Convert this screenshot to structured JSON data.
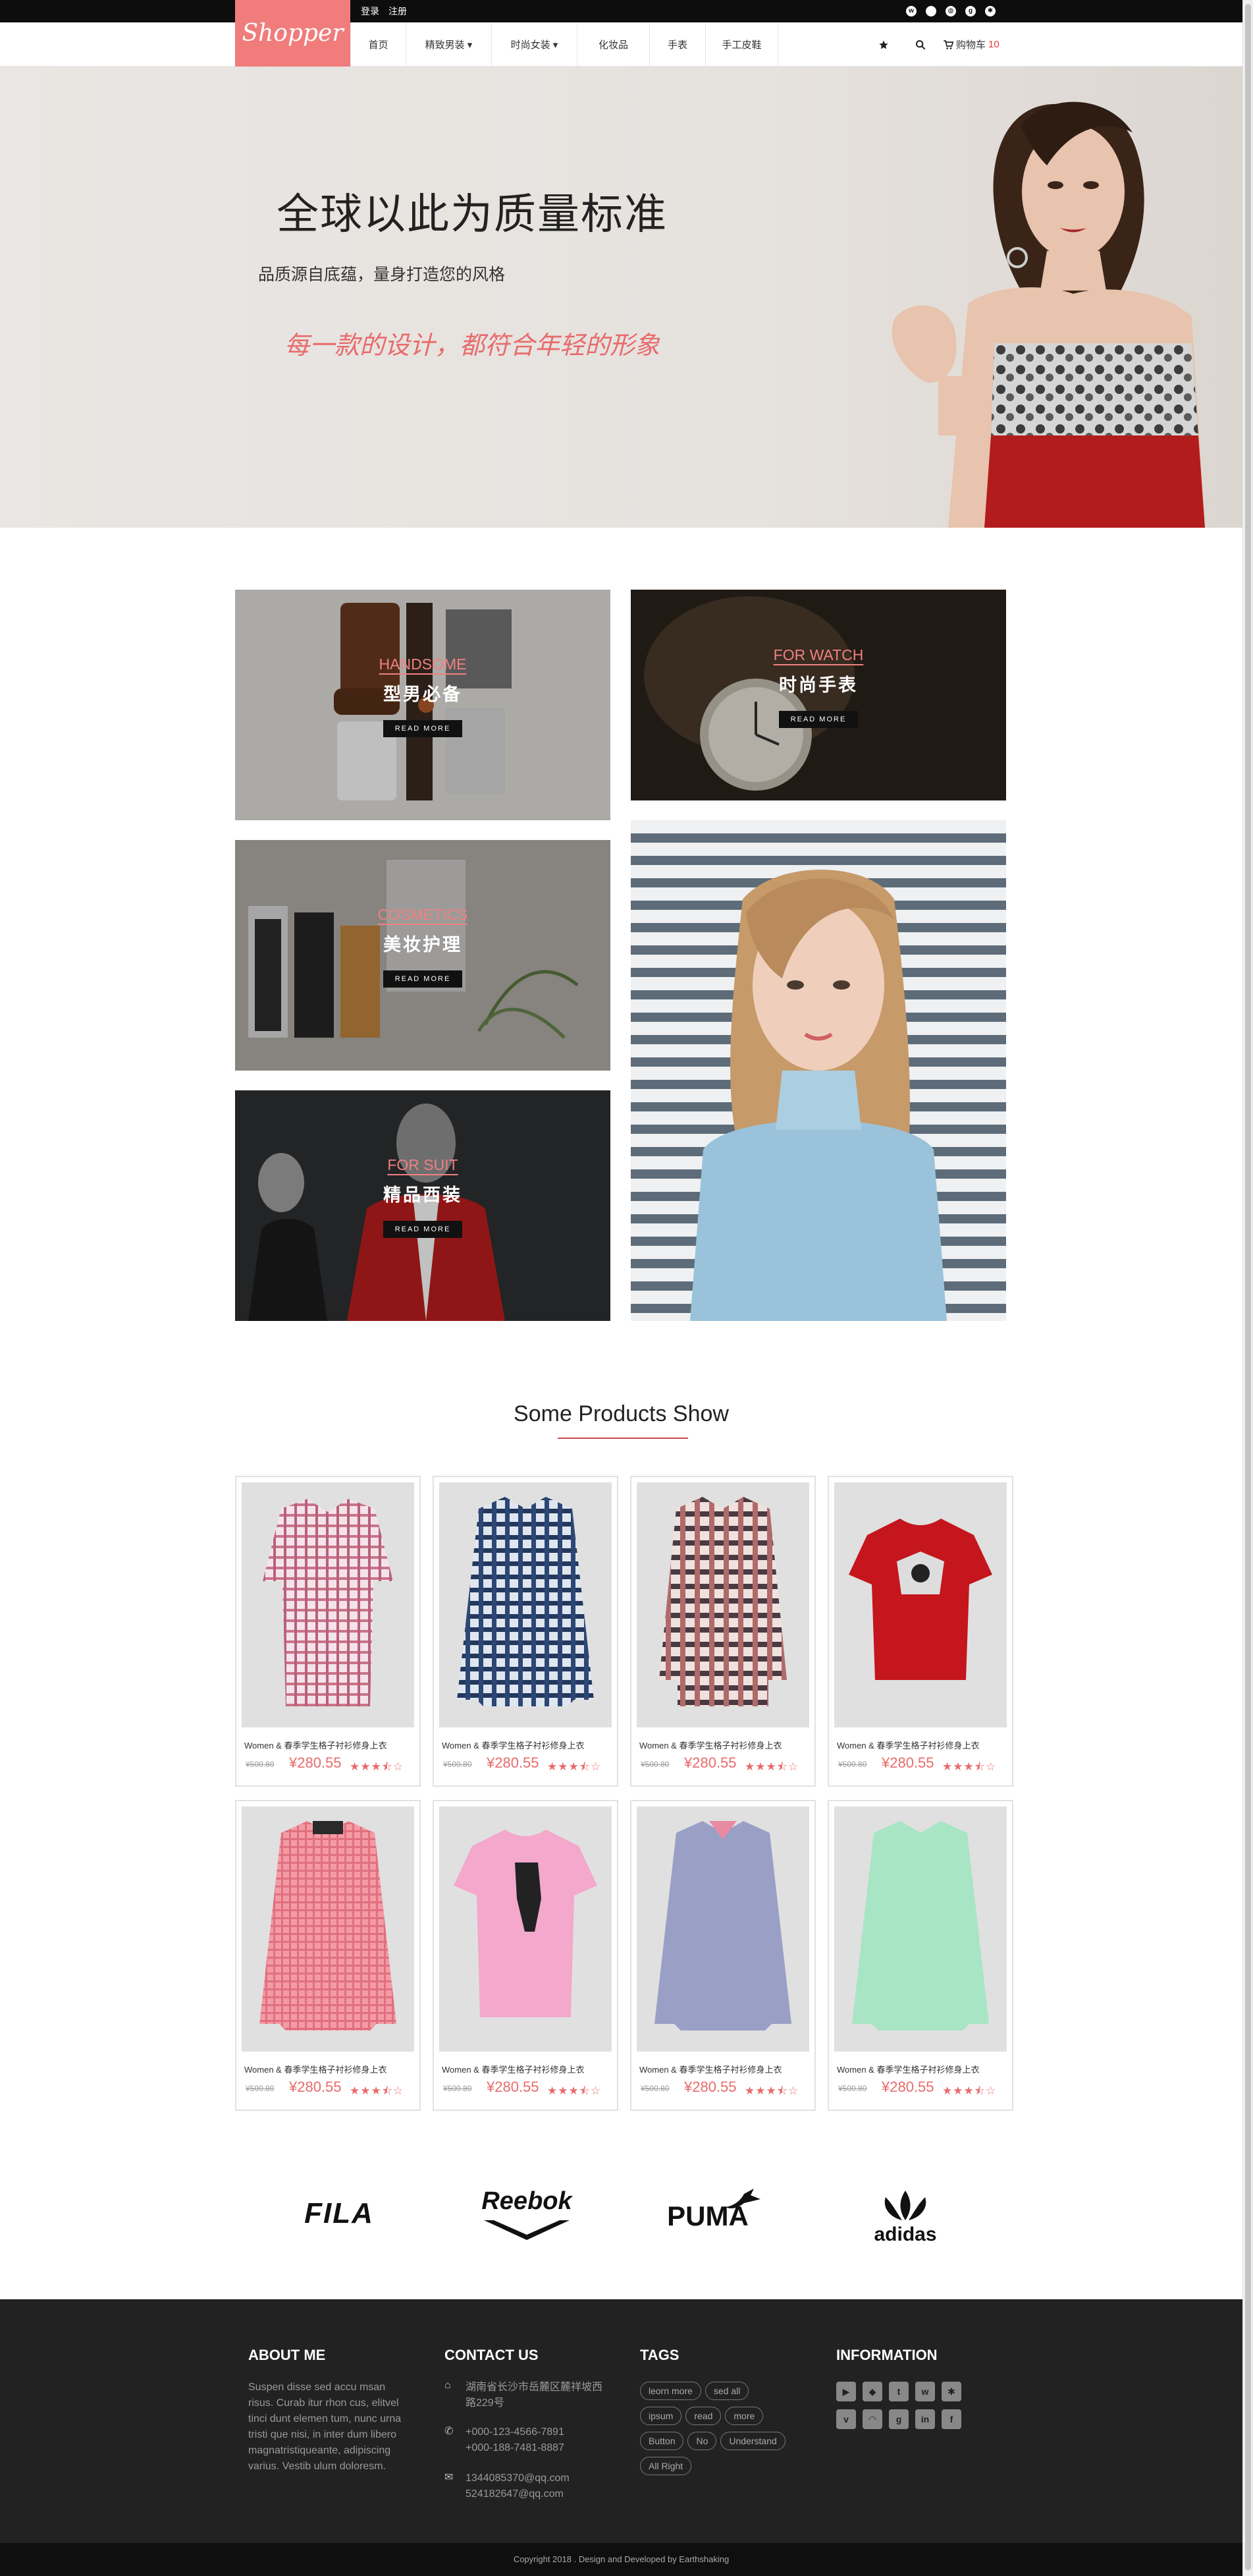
{
  "topbar": {
    "login": "登录",
    "register": "注册",
    "social": [
      "weibo-icon",
      "apple-icon",
      "dribbble-icon",
      "google-plus-icon",
      "yelp-icon"
    ]
  },
  "brand": {
    "logo": "Shopper"
  },
  "nav": [
    {
      "label": "首页"
    },
    {
      "label": "精致男装 ▾"
    },
    {
      "label": "时尚女装 ▾"
    },
    {
      "label": "化妆品"
    },
    {
      "label": "手表"
    },
    {
      "label": "手工皮鞋"
    }
  ],
  "navright": {
    "cart_label": "购物车",
    "cart_count": "10"
  },
  "hero": {
    "title": "全球以此为质量标准",
    "subtitle": "品质源自底蕴，量身打造您的风格",
    "tagline": "每一款的设计，都符合年轻的形象"
  },
  "categories": [
    {
      "en": "HANDSOME",
      "zh": "型男必备",
      "button": "READ MORE"
    },
    {
      "en": "FOR WATCH",
      "zh": "时尚手表",
      "button": "READ MORE"
    },
    {
      "en": "COSMETICS",
      "zh": "美妆护理",
      "button": "READ MORE"
    },
    {
      "en": "FOR SUIT",
      "zh": "精品西装",
      "button": "READ MORE"
    }
  ],
  "products_section": {
    "title": "Some Products Show"
  },
  "products": [
    {
      "name": "Women & 春季学生格子衬衫修身上衣",
      "old_price": "¥500.80",
      "price": "¥280.55",
      "stars": "★★★⯪☆"
    },
    {
      "name": "Women & 春季学生格子衬衫修身上衣",
      "old_price": "¥500.80",
      "price": "¥280.55",
      "stars": "★★★⯪☆"
    },
    {
      "name": "Women & 春季学生格子衬衫修身上衣",
      "old_price": "¥500.80",
      "price": "¥280.55",
      "stars": "★★★⯪☆"
    },
    {
      "name": "Women & 春季学生格子衬衫修身上衣",
      "old_price": "¥500.80",
      "price": "¥280.55",
      "stars": "★★★⯪☆"
    },
    {
      "name": "Women & 春季学生格子衬衫修身上衣",
      "old_price": "¥500.80",
      "price": "¥280.55",
      "stars": "★★★⯪☆"
    },
    {
      "name": "Women & 春季学生格子衬衫修身上衣",
      "old_price": "¥500.80",
      "price": "¥280.55",
      "stars": "★★★⯪☆"
    },
    {
      "name": "Women & 春季学生格子衬衫修身上衣",
      "old_price": "¥500.80",
      "price": "¥280.55",
      "stars": "★★★⯪☆"
    },
    {
      "name": "Women & 春季学生格子衬衫修身上衣",
      "old_price": "¥500.80",
      "price": "¥280.55",
      "stars": "★★★⯪☆"
    }
  ],
  "brands": [
    "FILA",
    "Reebok",
    "PUMA",
    "adidas"
  ],
  "footer": {
    "about_title": "ABOUT ME",
    "about_text": "Suspen disse sed accu msan risus. Curab itur rhon cus, elitvel tinci dunt elemen tum, nunc urna tristi que nisi, in inter dum libero magnatristiqueante, adipiscing varius. Vestib ulum doloresm.",
    "contact_title": "CONTACT US",
    "address": "湖南省长沙市岳麓区麓祥坡西路229号",
    "phone1": "+000-123-4566-7891",
    "phone2": "+000-188-7481-8887",
    "email1": "1344085370@qq.com",
    "email2": "524182647@qq.com",
    "tags_title": "TAGS",
    "tags": [
      "leorn more",
      "sed all",
      "ipsum",
      "read",
      "more",
      "Button",
      "No",
      "Understand",
      "All Right"
    ],
    "info_title": "INFORMATION",
    "info_icons": [
      "youtube-icon",
      "dropbox-icon",
      "twitter-icon",
      "weibo-icon",
      "yelp-icon",
      "vimeo-icon",
      "rss-icon",
      "google-plus-icon",
      "linkedin-icon",
      "facebook-icon"
    ],
    "copyright": "Copyright  2018 . Design and Developed by Earthshaking"
  }
}
